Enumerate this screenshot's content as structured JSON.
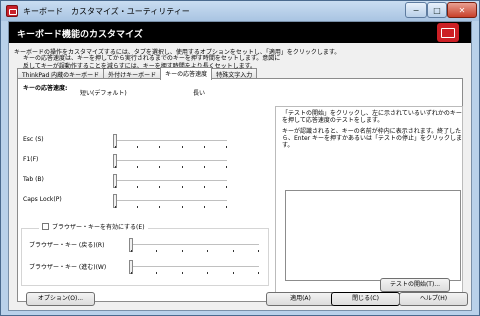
{
  "window": {
    "title": "キーボード　カスタマイズ・ユーティリティー",
    "min_label": "−",
    "max_label": "□",
    "close_label": "✕",
    "icon": "keyboard-app-icon"
  },
  "banner": {
    "title": "キーボード機能のカスタマイズ",
    "icon": "keyboard-icon",
    "brand_color": "#cc1f25"
  },
  "intro": "キーボードの操作をカスタマイズするには、タブを選択し、使用するオプションをセットし、「適用」をクリックします。",
  "tabs": [
    {
      "label": "ThinkPad 内蔵のキーボード",
      "active": false
    },
    {
      "label": "外付けキーボード",
      "active": false
    },
    {
      "label": "キーの応答速度",
      "active": true
    },
    {
      "label": "特殊文字入力",
      "active": false
    }
  ],
  "panel": {
    "group_title": "キーの応答速度:",
    "description": "キーの応答速度は、キーを押してから実行されるまでのキーを押す時間をセットします。意図に反してキーが誤動作することを減らすには、キーを押す時間をより長くセットします。",
    "scale_short": "短い(デフォルト)",
    "scale_long": "長い",
    "sliders": [
      {
        "label": "Esc (S)",
        "value": 0
      },
      {
        "label": "F1(F)",
        "value": 0
      },
      {
        "label": "Tab (B)",
        "value": 0
      },
      {
        "label": "Caps Lock(P)",
        "value": 0
      }
    ],
    "browser_checkbox_label": "ブラウザー・キーを有効にする(E)",
    "browser_checked": false,
    "browser_sliders": [
      {
        "label": "ブラウザー・キー (戻る)(R)",
        "value": 0
      },
      {
        "label": "ブラウザー・キー (進む)(W)",
        "value": 0
      }
    ],
    "right_text_1": "「テストの開始」をクリックし、左に示されているいずれかのキーを押して応答速度のテストをします。",
    "right_text_2": "キーが認識されると、キーの名前が枠内に表示されます。終了したら、Enter キーを押すかあるいは「テストの停止」をクリックします。",
    "test_button": "テストの開始(T)..."
  },
  "footer": {
    "options": "オプション(O)...",
    "apply": "適用(A)",
    "close": "閉じる(C)",
    "help": "ヘルプ(H)"
  }
}
